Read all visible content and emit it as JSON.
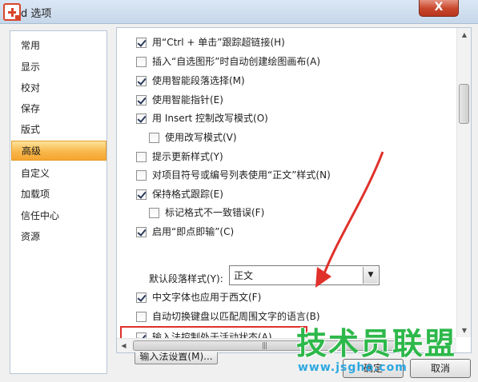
{
  "window": {
    "title": "d 选项",
    "close_label": "X"
  },
  "sidebar": {
    "items": [
      {
        "label": "常用"
      },
      {
        "label": "显示"
      },
      {
        "label": "校对"
      },
      {
        "label": "保存"
      },
      {
        "label": "版式"
      },
      {
        "label": "高级",
        "selected": true
      },
      {
        "label": "自定义"
      },
      {
        "label": "加载项"
      },
      {
        "label": "信任中心"
      },
      {
        "label": "资源"
      }
    ]
  },
  "options": [
    {
      "label": "用“Ctrl + 单击”跟踪超链接(H)",
      "checked": true
    },
    {
      "label": "插入“自选图形”时自动创建绘图画布(A)",
      "checked": false
    },
    {
      "label": "使用智能段落选择(M)",
      "checked": true
    },
    {
      "label": "使用智能指针(E)",
      "checked": true
    },
    {
      "label": "用 Insert 控制改写模式(O)",
      "checked": true
    },
    {
      "label": "使用改写模式(V)",
      "checked": false
    },
    {
      "label": "提示更新样式(Y)",
      "checked": false
    },
    {
      "label": "对项目符号或编号列表使用“正文”样式(N)",
      "checked": false
    },
    {
      "label": "保持格式跟踪(E)",
      "checked": true
    },
    {
      "label": "标记格式不一致错误(F)",
      "checked": false
    },
    {
      "label": "启用“即点即输”(C)",
      "checked": true
    },
    {
      "label": "中文字体也应用于西文(F)",
      "checked": true
    },
    {
      "label": "自动切换键盘以匹配周围文字的语言(B)",
      "checked": false
    },
    {
      "label": "输入法控制处于活动状态(A)",
      "checked": true
    }
  ],
  "default_paragraph_style": {
    "label": "默认段落样式(Y):",
    "value": "正文"
  },
  "ime_settings_label": "输入法设置(M)...",
  "footer": {
    "ok_label": "确定",
    "cancel_label": "取消"
  },
  "watermark": {
    "text": "技术员联盟",
    "url": "www.jsgho.com"
  },
  "colors": {
    "selected_gradient": "#f9b74a",
    "highlight_red": "#e0302a",
    "watermark_green": "#2db84a",
    "watermark_blue": "#2da8e0"
  }
}
